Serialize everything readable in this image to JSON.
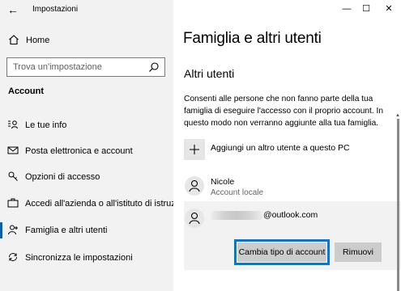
{
  "window": {
    "title": "Impostazioni",
    "controls": {
      "minimize": "—",
      "maximize": "☐",
      "close": "✕"
    }
  },
  "sidebar": {
    "back_icon": "←",
    "home_label": "Home",
    "search_placeholder": "Trova un'impostazione",
    "section_label": "Account",
    "items": [
      {
        "label": "Le tue info",
        "icon": "person-card-icon",
        "selected": false
      },
      {
        "label": "Posta elettronica e account",
        "icon": "mail-icon",
        "selected": false
      },
      {
        "label": "Opzioni di accesso",
        "icon": "key-icon",
        "selected": false
      },
      {
        "label": "Accedi all'azienda o all'istituto di istruzione",
        "icon": "briefcase-icon",
        "selected": false
      },
      {
        "label": "Famiglia e altri utenti",
        "icon": "person-add-icon",
        "selected": true
      },
      {
        "label": "Sincronizza le impostazioni",
        "icon": "sync-icon",
        "selected": false
      }
    ]
  },
  "main": {
    "title": "Famiglia e altri utenti",
    "section_title": "Altri utenti",
    "description": "Consenti alle persone che non fanno parte della tua famiglia di eseguire l'accesso con il proprio account. In questo modo non verranno aggiunte alla tua famiglia.",
    "add_user_label": "Aggiungi un altro utente a questo PC",
    "users": [
      {
        "name": "Nicole",
        "type": "Account locale"
      },
      {
        "email_suffix": "@outlook.com"
      }
    ],
    "change_type_button": "Cambia tipo di account",
    "remove_button": "Rimuovi"
  },
  "colors": {
    "accent": "#0078d7",
    "sidebar_bg": "#f2f2f2",
    "button_bg": "#cccccc"
  }
}
